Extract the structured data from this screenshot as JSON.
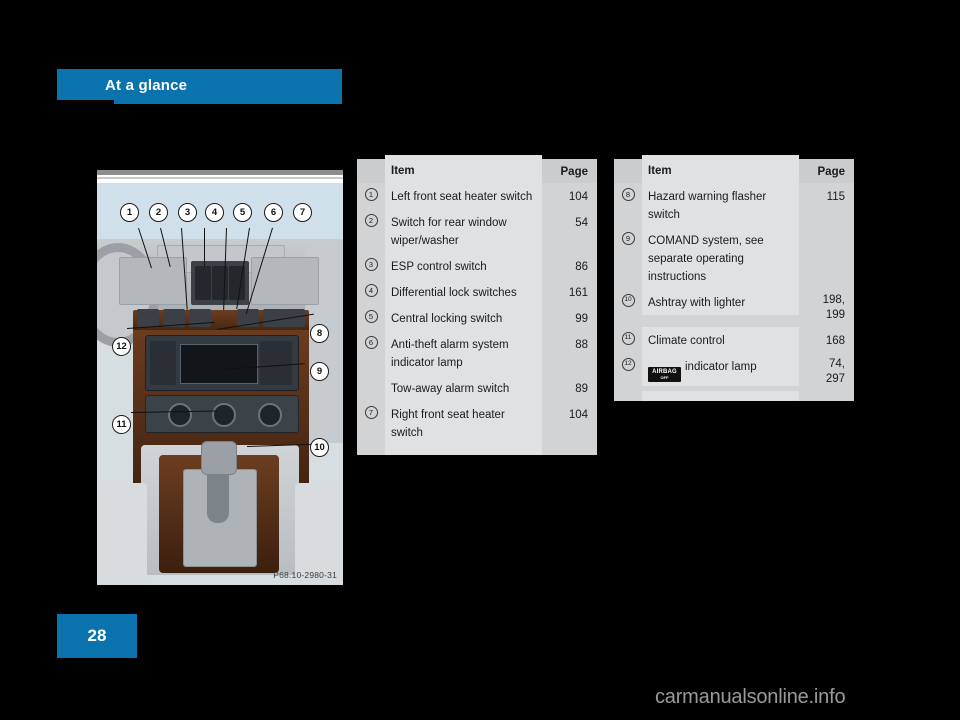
{
  "section": {
    "header_label": "At a glance",
    "page_number": "28",
    "accent_color": "#0a72ad"
  },
  "watermark": "carmanualsonline.info",
  "figure": {
    "caption": "P68.10-2980-31",
    "callouts": [
      "1",
      "2",
      "3",
      "4",
      "5",
      "6",
      "7",
      "8",
      "9",
      "10",
      "11",
      "12"
    ]
  },
  "tables": [
    {
      "name": "left-table",
      "head": {
        "item": "Item",
        "page": "Page"
      },
      "rows": [
        {
          "num": "1",
          "item": "Left front seat heater switch",
          "page": "104"
        },
        {
          "num": "2",
          "item": "Switch for rear window wiper/washer",
          "page": "54"
        },
        {
          "num": "3",
          "item": "ESP control switch",
          "page": "86"
        },
        {
          "num": "4",
          "item": "Differential lock switches",
          "page": "161"
        },
        {
          "num": "5",
          "item": "Central locking switch",
          "page": "99"
        },
        {
          "num": "6",
          "item": "Anti-theft alarm system indicator lamp",
          "page": "88"
        },
        {
          "num": "",
          "item": "Tow-away alarm switch",
          "page": "89"
        },
        {
          "num": "7",
          "item": "Right front seat heater switch",
          "page": "104"
        }
      ]
    },
    {
      "name": "right-table",
      "head": {
        "item": "Item",
        "page": "Page"
      },
      "rows": [
        {
          "num": "8",
          "item": "Hazard warning flasher switch",
          "page": "115"
        },
        {
          "num": "9",
          "item": "COMAND system, see separate operating instructions",
          "page": ""
        },
        {
          "num": "10",
          "item": "Ashtray with lighter",
          "page": "198, 199"
        },
        {
          "num": "11",
          "item": "Climate control",
          "page": "168"
        },
        {
          "num": "12",
          "item": "indicator lamp",
          "badge": {
            "top": "AIRBAG",
            "bottom": "OFF"
          },
          "page": "74, 297"
        }
      ]
    }
  ]
}
